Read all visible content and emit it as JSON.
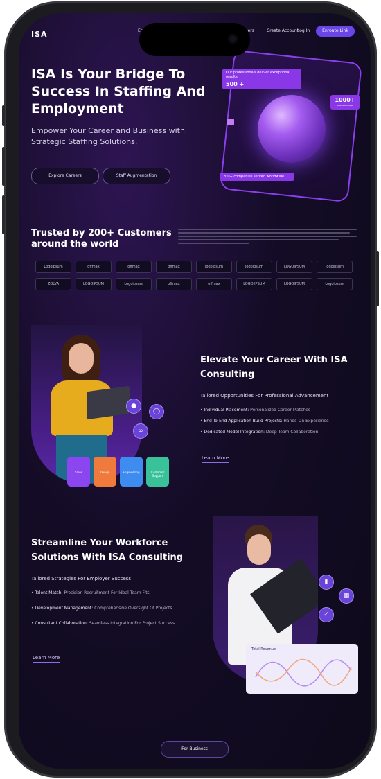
{
  "nav": {
    "logo": "ISA",
    "link_1": "Eor",
    "link_2": "Parsers",
    "create_account": "Create Account",
    "login": "Log In",
    "cta": "Enroute Link"
  },
  "hero": {
    "title": "ISA Is Your Bridge To Success In Staffing And Employment",
    "subtitle": "Empower Your Career and Business with Strategic Staffing Solutions.",
    "btn_explore": "Explore Careers",
    "btn_staff": "Staff Augmentation",
    "badge_pros": "Our professionals deliver exceptional results",
    "badge_pros_count": "500 +",
    "badge_candidates_value": "1000+",
    "badge_candidates_label": "Qualified People",
    "badge_companies": "200+ companies served worldwide"
  },
  "trusted": {
    "title": "Trusted by 200+ Customers around the world",
    "logos_row1": [
      "Logoipsum",
      "offmax",
      "offmax",
      "offmax",
      "logoipsum",
      "logoipsum",
      "LOGOIPSUM",
      "logoipsum"
    ],
    "logos_row2": [
      "ZOLVA",
      "LOGOIPSUM",
      "Logoipsum",
      "offmax",
      "offmax",
      "LOGO IPSUM",
      "LOGOIPSUM",
      "Logoipsum"
    ]
  },
  "career": {
    "title": "Elevate Your Career With ISA Consulting",
    "subtitle": "Tailored Opportunities For Professional Advancement",
    "bullets": [
      {
        "label": "Individual Placement:",
        "text": "Personalized Career Matches"
      },
      {
        "label": "End-To-End Application Build Projects:",
        "text": "Hands-On Experience"
      },
      {
        "label": "Dedicated Model Integration:",
        "text": "Deep Team Collaboration"
      }
    ],
    "learn_more": "Learn More",
    "tiles": [
      {
        "label": "Sales",
        "color": "#8b46f0"
      },
      {
        "label": "Design",
        "color": "#f07a3c"
      },
      {
        "label": "Engineering",
        "color": "#3e8cf0"
      },
      {
        "label": "Customer Support",
        "color": "#39c29a"
      }
    ]
  },
  "workforce": {
    "title": "Streamline Your Workforce Solutions With ISA Consulting",
    "subtitle": "Tailored Strategies For Employer Success",
    "bullets": [
      {
        "label": "Talent Match:",
        "text": "Precision Recruitment For Ideal Team Fits"
      },
      {
        "label": "Development Management:",
        "text": "Comprehensive Oversight Of Projects."
      },
      {
        "label": "Consultant Collaboration:",
        "text": "Seamless Integration For Project Success."
      }
    ],
    "learn_more": "Learn More",
    "revenue_title": "Total Revenue"
  },
  "bottom_button": "For Business",
  "colors": {
    "accent": "#6a45e8",
    "card_purple": "#8a37e8",
    "background": "#120b22"
  }
}
